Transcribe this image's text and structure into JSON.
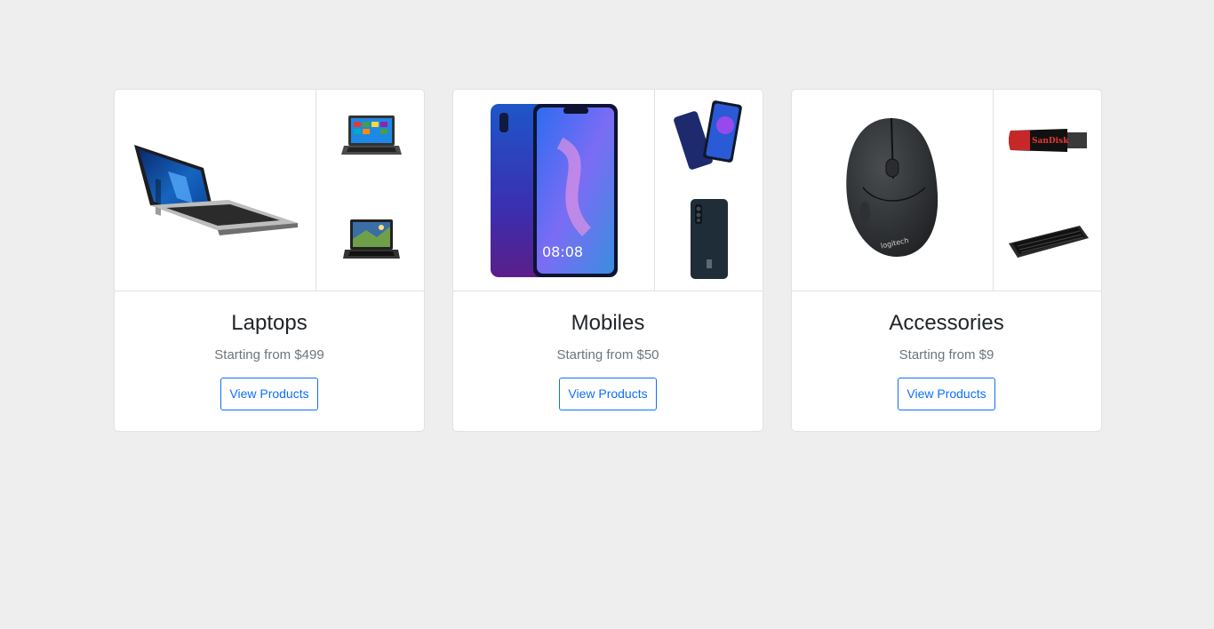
{
  "categories": [
    {
      "title": "Laptops",
      "subtitle": "Starting from $499",
      "button_label": "View Products",
      "main_image": "laptop-image",
      "side_images": [
        "laptop-small-image",
        "laptop-small-image"
      ]
    },
    {
      "title": "Mobiles",
      "subtitle": "Starting from $50",
      "button_label": "View Products",
      "main_image": "smartphone-image",
      "side_images": [
        "smartphone-pair-image",
        "smartphone-back-image"
      ]
    },
    {
      "title": "Accessories",
      "subtitle": "Starting from $9",
      "button_label": "View Products",
      "main_image": "mouse-image",
      "side_images": [
        "usb-drive-image",
        "keyboard-image"
      ]
    }
  ],
  "product_images": {
    "mouse_brand": "logitech",
    "usb_brand": "SanDisk",
    "phone_clock": "08:08"
  },
  "colors": {
    "page_background": "#eeeeee",
    "card_background": "#ffffff",
    "border": "#dee2e6",
    "accent": "#0d6efd",
    "muted_text": "#6c757d"
  }
}
